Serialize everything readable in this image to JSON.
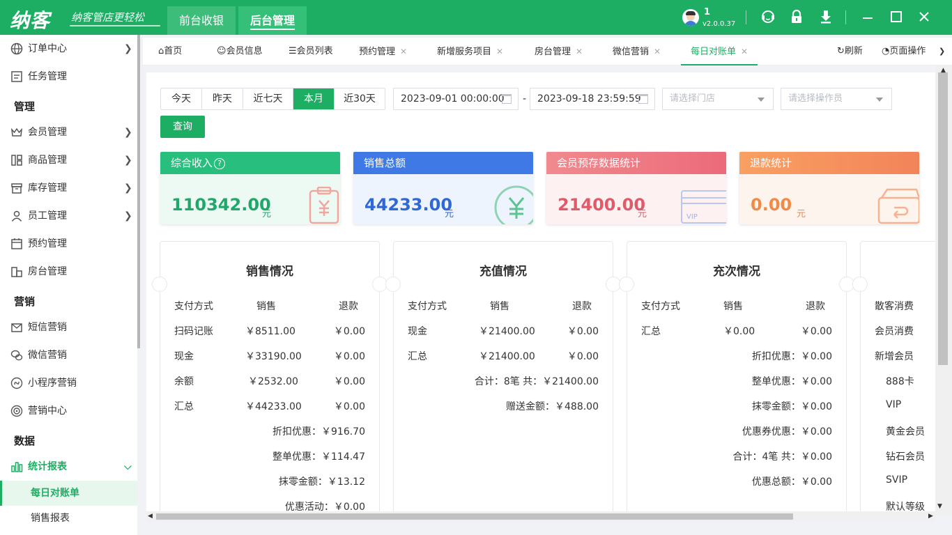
{
  "app": {
    "logo": "纳客",
    "slogan": "纳客管店更轻松",
    "top_tabs": [
      "前台收银",
      "后台管理"
    ],
    "user": "1",
    "version": "v2.0.0.37"
  },
  "sidebar": {
    "items": [
      {
        "label": "订单中心",
        "icon": "globe-icon",
        "chevron": true
      },
      {
        "label": "任务管理",
        "icon": "task-icon",
        "chevron": false
      }
    ],
    "group_manage": "管理",
    "manage_items": [
      {
        "label": "会员管理",
        "icon": "crown-icon"
      },
      {
        "label": "商品管理",
        "icon": "goods-icon"
      },
      {
        "label": "库存管理",
        "icon": "inventory-icon"
      },
      {
        "label": "员工管理",
        "icon": "staff-icon"
      },
      {
        "label": "预约管理",
        "icon": "calendar-icon"
      },
      {
        "label": "房台管理",
        "icon": "room-icon"
      }
    ],
    "group_marketing": "营销",
    "marketing_items": [
      {
        "label": "短信营销",
        "icon": "mail-icon"
      },
      {
        "label": "微信营销",
        "icon": "wechat-icon"
      },
      {
        "label": "小程序营销",
        "icon": "miniprogram-icon"
      },
      {
        "label": "营销中心",
        "icon": "target-icon"
      }
    ],
    "group_data": "数据",
    "report": {
      "label": "统计报表",
      "icon": "chart-icon"
    },
    "report_subs": [
      "每日对账单",
      "销售报表"
    ]
  },
  "tabs": [
    {
      "label": "首页",
      "icon": "home-icon",
      "closable": false
    },
    {
      "label": "会员信息",
      "icon": "user-icon",
      "closable": false
    },
    {
      "label": "会员列表",
      "icon": "list-icon",
      "closable": false
    },
    {
      "label": "预约管理",
      "closable": true
    },
    {
      "label": "新增服务项目",
      "closable": true
    },
    {
      "label": "房台管理",
      "closable": true
    },
    {
      "label": "微信营销",
      "closable": true
    },
    {
      "label": "每日对账单",
      "closable": true
    }
  ],
  "tab_actions": {
    "refresh": "刷新",
    "page_ops": "页面操作"
  },
  "filters": {
    "ranges": [
      "今天",
      "昨天",
      "近七天",
      "本月",
      "近30天"
    ],
    "selected_range": "本月",
    "start": "2023-09-01 00:00:00",
    "end": "2023-09-18 23:59:59",
    "separator": "-",
    "store_placeholder": "请选择门店",
    "operator_placeholder": "请选择操作员",
    "query": "查询"
  },
  "stat_cards": [
    {
      "title": "综合收入",
      "value": "110342.00",
      "unit": "元",
      "color": "#28bf7e",
      "help": "?"
    },
    {
      "title": "销售总额",
      "value": "44233.00",
      "unit": "元",
      "color": "#3e79e6"
    },
    {
      "title": "会员预存数据统计",
      "value": "21400.00",
      "unit": "元",
      "color": "#ef6a77",
      "deco_text": "VIP"
    },
    {
      "title": "退款统计",
      "value": "0.00",
      "unit": "元",
      "color": "#f7905a"
    }
  ],
  "sales": {
    "title": "销售情况",
    "headers": [
      "支付方式",
      "销售",
      "退款"
    ],
    "rows": [
      [
        "扫码记账",
        "￥8511.00",
        "￥0.00"
      ],
      [
        "现金",
        "￥33190.00",
        "￥0.00"
      ],
      [
        "余额",
        "￥2532.00",
        "￥0.00"
      ],
      [
        "汇总",
        "￥44233.00",
        "￥0.00"
      ]
    ],
    "totals": [
      "折扣优惠：￥916.70",
      "整单优惠：￥114.47",
      "抹零金额：￥13.12",
      "优惠活动：￥0.00"
    ]
  },
  "recharge": {
    "title": "充值情况",
    "headers": [
      "支付方式",
      "销售",
      "退款"
    ],
    "rows": [
      [
        "现金",
        "￥21400.00",
        "￥0.00"
      ],
      [
        "汇总",
        "￥21400.00",
        "￥0.00"
      ]
    ],
    "totals": [
      "合计：8笔 共：￥21400.00",
      "赠送金额：￥488.00"
    ]
  },
  "count_recharge": {
    "title": "充次情况",
    "headers": [
      "支付方式",
      "销售",
      "退款"
    ],
    "rows": [
      [
        "汇总",
        "￥0.00",
        "￥0.00"
      ]
    ],
    "totals": [
      "折扣优惠：￥0.00",
      "整单优惠：￥0.00",
      "抹零金额：￥0.00",
      "优惠券优惠：￥0.00",
      "合计：4笔 共：￥0.00",
      "优惠总额：￥0.00"
    ]
  },
  "consume": {
    "items": [
      "散客消费",
      "会员消费",
      "新增会员",
      "888卡",
      "VIP",
      "黄金会员",
      "钻石会员",
      "SVIP",
      "默认等级"
    ]
  }
}
